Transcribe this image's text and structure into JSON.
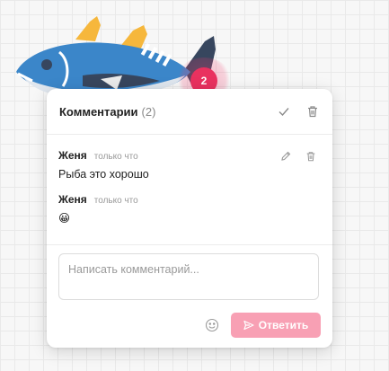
{
  "badge": {
    "count": "2"
  },
  "panel": {
    "title": "Комментарии",
    "count": "(2)"
  },
  "comments": [
    {
      "author": "Женя",
      "time": "только что",
      "text": "Рыба это хорошо"
    },
    {
      "author": "Женя",
      "time": "только что",
      "text": "😀"
    }
  ],
  "composer": {
    "placeholder": "Написать комментарий...",
    "reply_label": "Ответить"
  },
  "icons": {
    "resolve": "check-icon",
    "delete": "trash-icon",
    "edit": "pencil-icon",
    "emoji": "smiley-icon",
    "send": "send-icon"
  },
  "colors": {
    "accent": "#e9315f",
    "reply_button": "#f8a0b4",
    "fish_body": "#3b86c9",
    "fish_fin": "#f6b73c"
  }
}
